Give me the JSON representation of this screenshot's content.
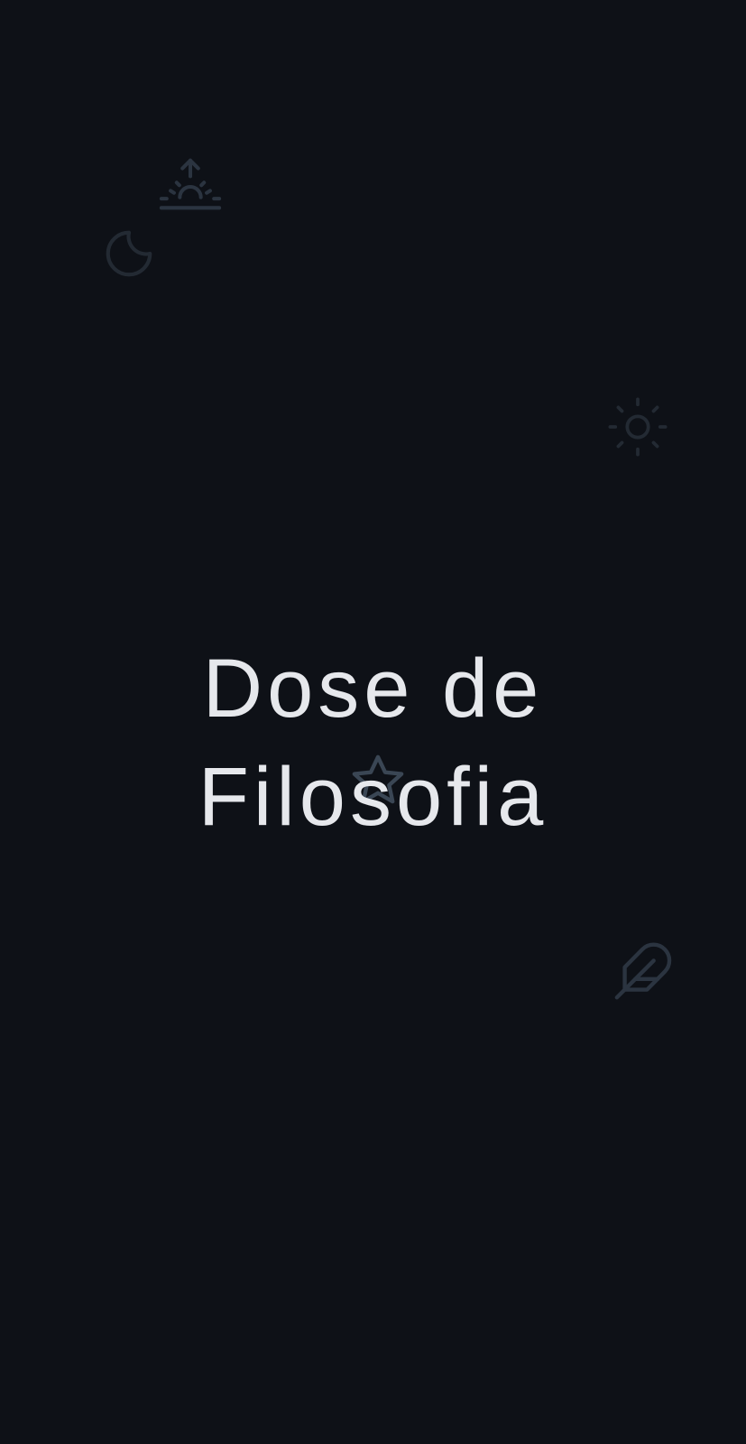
{
  "splash": {
    "title_line_1": "Dose de",
    "title_line_2": "Filosofia"
  },
  "decorative_icons": [
    "sunrise-icon",
    "moon-icon",
    "sun-icon",
    "star-icon",
    "feather-icon"
  ],
  "colors": {
    "background": "#0e1117",
    "title": "#e6e8ec",
    "icon_dim": "#232a33",
    "icon_mid": "#2b3440",
    "icon_bright": "#3a4654"
  }
}
